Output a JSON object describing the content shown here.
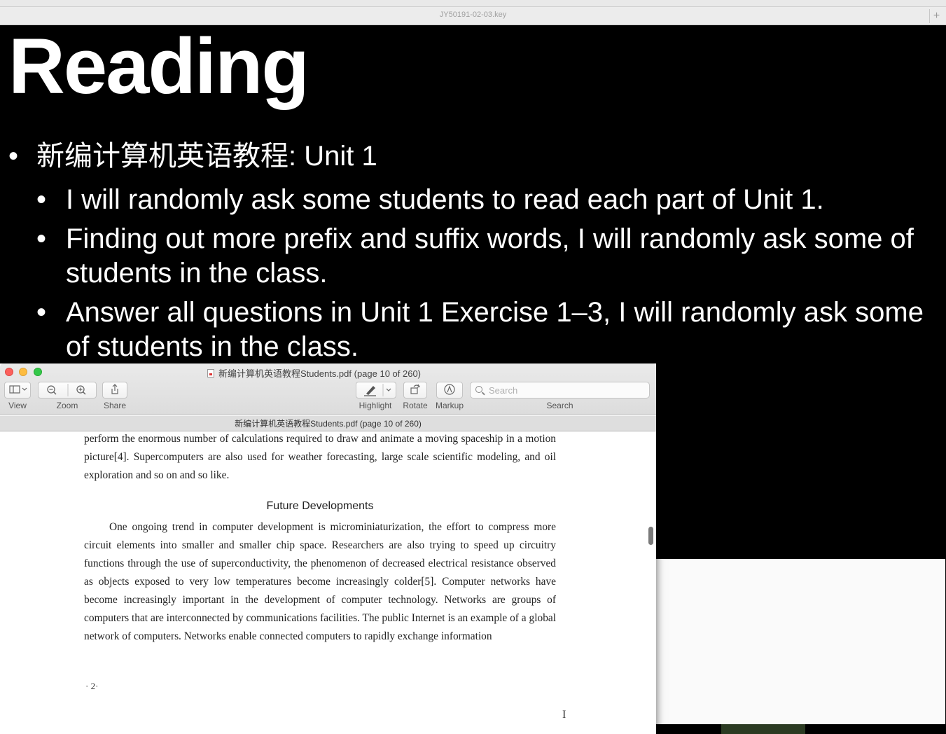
{
  "keynote": {
    "document_title": "JY50191-02-03.key",
    "add_button": "+"
  },
  "slide": {
    "title": "Reading",
    "bullets": [
      {
        "level": 1,
        "text": "新编计算机英语教程: Unit 1"
      },
      {
        "level": 2,
        "text": "I will randomly ask some students to read each part of Unit 1."
      },
      {
        "level": 2,
        "text": "Finding out more prefix and suffix words, I will randomly ask some of students in the class."
      },
      {
        "level": 2,
        "text": "Answer all questions in Unit 1 Exercise 1–3, I will randomly ask some of students in the class."
      }
    ],
    "bullet_glyph": "•"
  },
  "preview": {
    "window_title": "新编计算机英语教程Students.pdf (page 10 of 260)",
    "subtitle": "新编计算机英语教程Students.pdf (page 10 of 260)",
    "toolbar": {
      "view_label": "View",
      "zoom_label": "Zoom",
      "share_label": "Share",
      "highlight_label": "Highlight",
      "rotate_label": "Rotate",
      "markup_label": "Markup",
      "search_label": "Search",
      "search_placeholder": "Search"
    },
    "page": {
      "paragraph1": "perform the enormous number of calculations required to draw and animate a moving spaceship in a motion picture[4]. Supercomputers are also used for weather forecasting, large scale scientific modeling, and oil exploration and so on and so like.",
      "heading": "Future Developments",
      "paragraph2": "One ongoing trend in computer development is microminiaturization, the effort to compress more circuit elements into smaller and smaller chip space. Researchers are also trying to speed up circuitry functions through the use of superconductivity, the phenomenon of decreased electrical resistance observed as objects exposed to very low temperatures become increasingly colder[5]. Computer networks have become increasingly important in the development of computer technology. Networks are groups of computers that are interconnected by communications facilities. The public Internet is an example of a global network of computers. Networks enable connected computers to rapidly exchange information",
      "page_number": "· 2·"
    }
  }
}
